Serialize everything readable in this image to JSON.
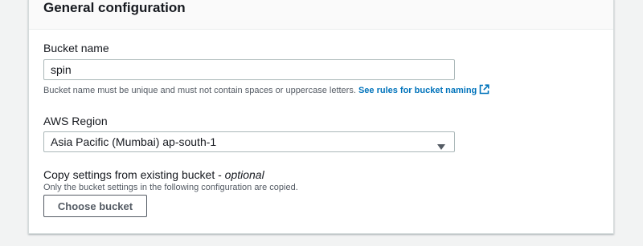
{
  "section": {
    "title": "General configuration"
  },
  "bucket_name": {
    "label": "Bucket name",
    "value": "spin",
    "hint": "Bucket name must be unique and must not contain spaces or uppercase letters.",
    "rules_link": "See rules for bucket naming",
    "rules_icon": "external-link-icon"
  },
  "region": {
    "label": "AWS Region",
    "selected": "Asia Pacific (Mumbai) ap-south-1",
    "caret_icon": "caret-down-icon"
  },
  "copy_settings": {
    "label": "Copy settings from existing bucket - ",
    "optional": "optional",
    "hint": "Only the bucket settings in the following configuration are copied.",
    "button_label": "Choose bucket"
  },
  "colors": {
    "link": "#0073bb",
    "page_background": "#f2f3f3",
    "panel_background": "#ffffff",
    "text": "#16191f",
    "secondary_text": "#545b64"
  }
}
